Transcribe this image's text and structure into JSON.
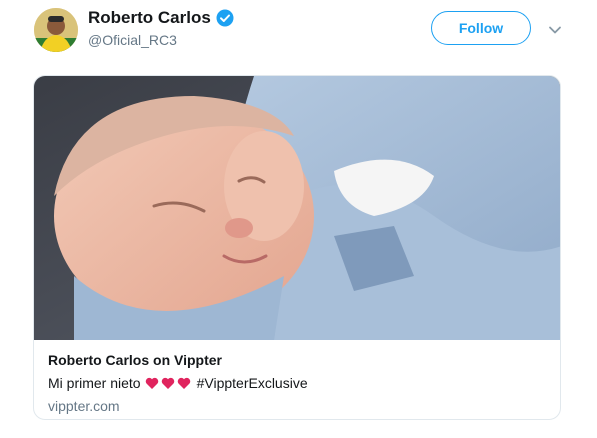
{
  "user": {
    "display_name": "Roberto Carlos",
    "handle": "@Oficial_RC3",
    "verified": true,
    "avatar_icon": "avatar-photo"
  },
  "actions": {
    "follow_label": "Follow",
    "menu_icon": "chevron-down-icon"
  },
  "card": {
    "image_icon": "sleeping-baby-photo",
    "title": "Roberto Carlos on Vippter",
    "description_prefix": "Mi primer nieto",
    "hearts": 3,
    "hashtag": "#VippterExclusive",
    "domain": "vippter.com"
  },
  "colors": {
    "accent": "#1da1f2",
    "heart": "#e0245e",
    "secondary_text": "#657786"
  }
}
